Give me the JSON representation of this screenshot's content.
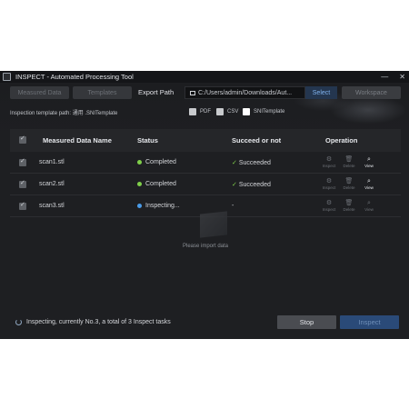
{
  "window": {
    "title": "INSPECT - Automated Processing Tool",
    "minimize": "—",
    "close": "✕"
  },
  "toolbar": {
    "measured_data_label": "Measured Data",
    "templates_label": "Templates",
    "export_path_label": "Export Path",
    "export_path_value": "C:/Users/admin/Downloads/Aut...",
    "select_label": "Select",
    "workspace_label": "Workspace"
  },
  "options": {
    "template_path_text": "Inspection template path: 通用 .SNITemplate",
    "pdf_label": "PDF",
    "csv_label": "CSV",
    "snitemplate_label": "SNITemplate"
  },
  "table": {
    "columns": [
      "Measured Data Name",
      "Status",
      "Succeed or not",
      "Operation"
    ],
    "rows": [
      {
        "name": "scan1.stl",
        "status": "Completed",
        "status_color": "#7fcf4a",
        "result": "Succeeded",
        "result_icon": "✓"
      },
      {
        "name": "scan2.stl",
        "status": "Completed",
        "status_color": "#7fcf4a",
        "result": "Succeeded",
        "result_icon": "✓"
      },
      {
        "name": "scan3.stl",
        "status": "Inspecting...",
        "status_color": "#4a9be8",
        "result": "-",
        "result_icon": ""
      }
    ],
    "operations": {
      "inspect": "Inspect",
      "delete": "Delete",
      "view": "View"
    },
    "empty_text": "Please import data"
  },
  "footer": {
    "progress_text": "Inspecting, currently No.3, a total of 3 Inspect tasks",
    "stop_label": "Stop",
    "inspect_label": "Inspect"
  },
  "colors": {
    "accent": "#2a4a78",
    "success": "#7fcf4a",
    "in_progress": "#4a9be8"
  }
}
